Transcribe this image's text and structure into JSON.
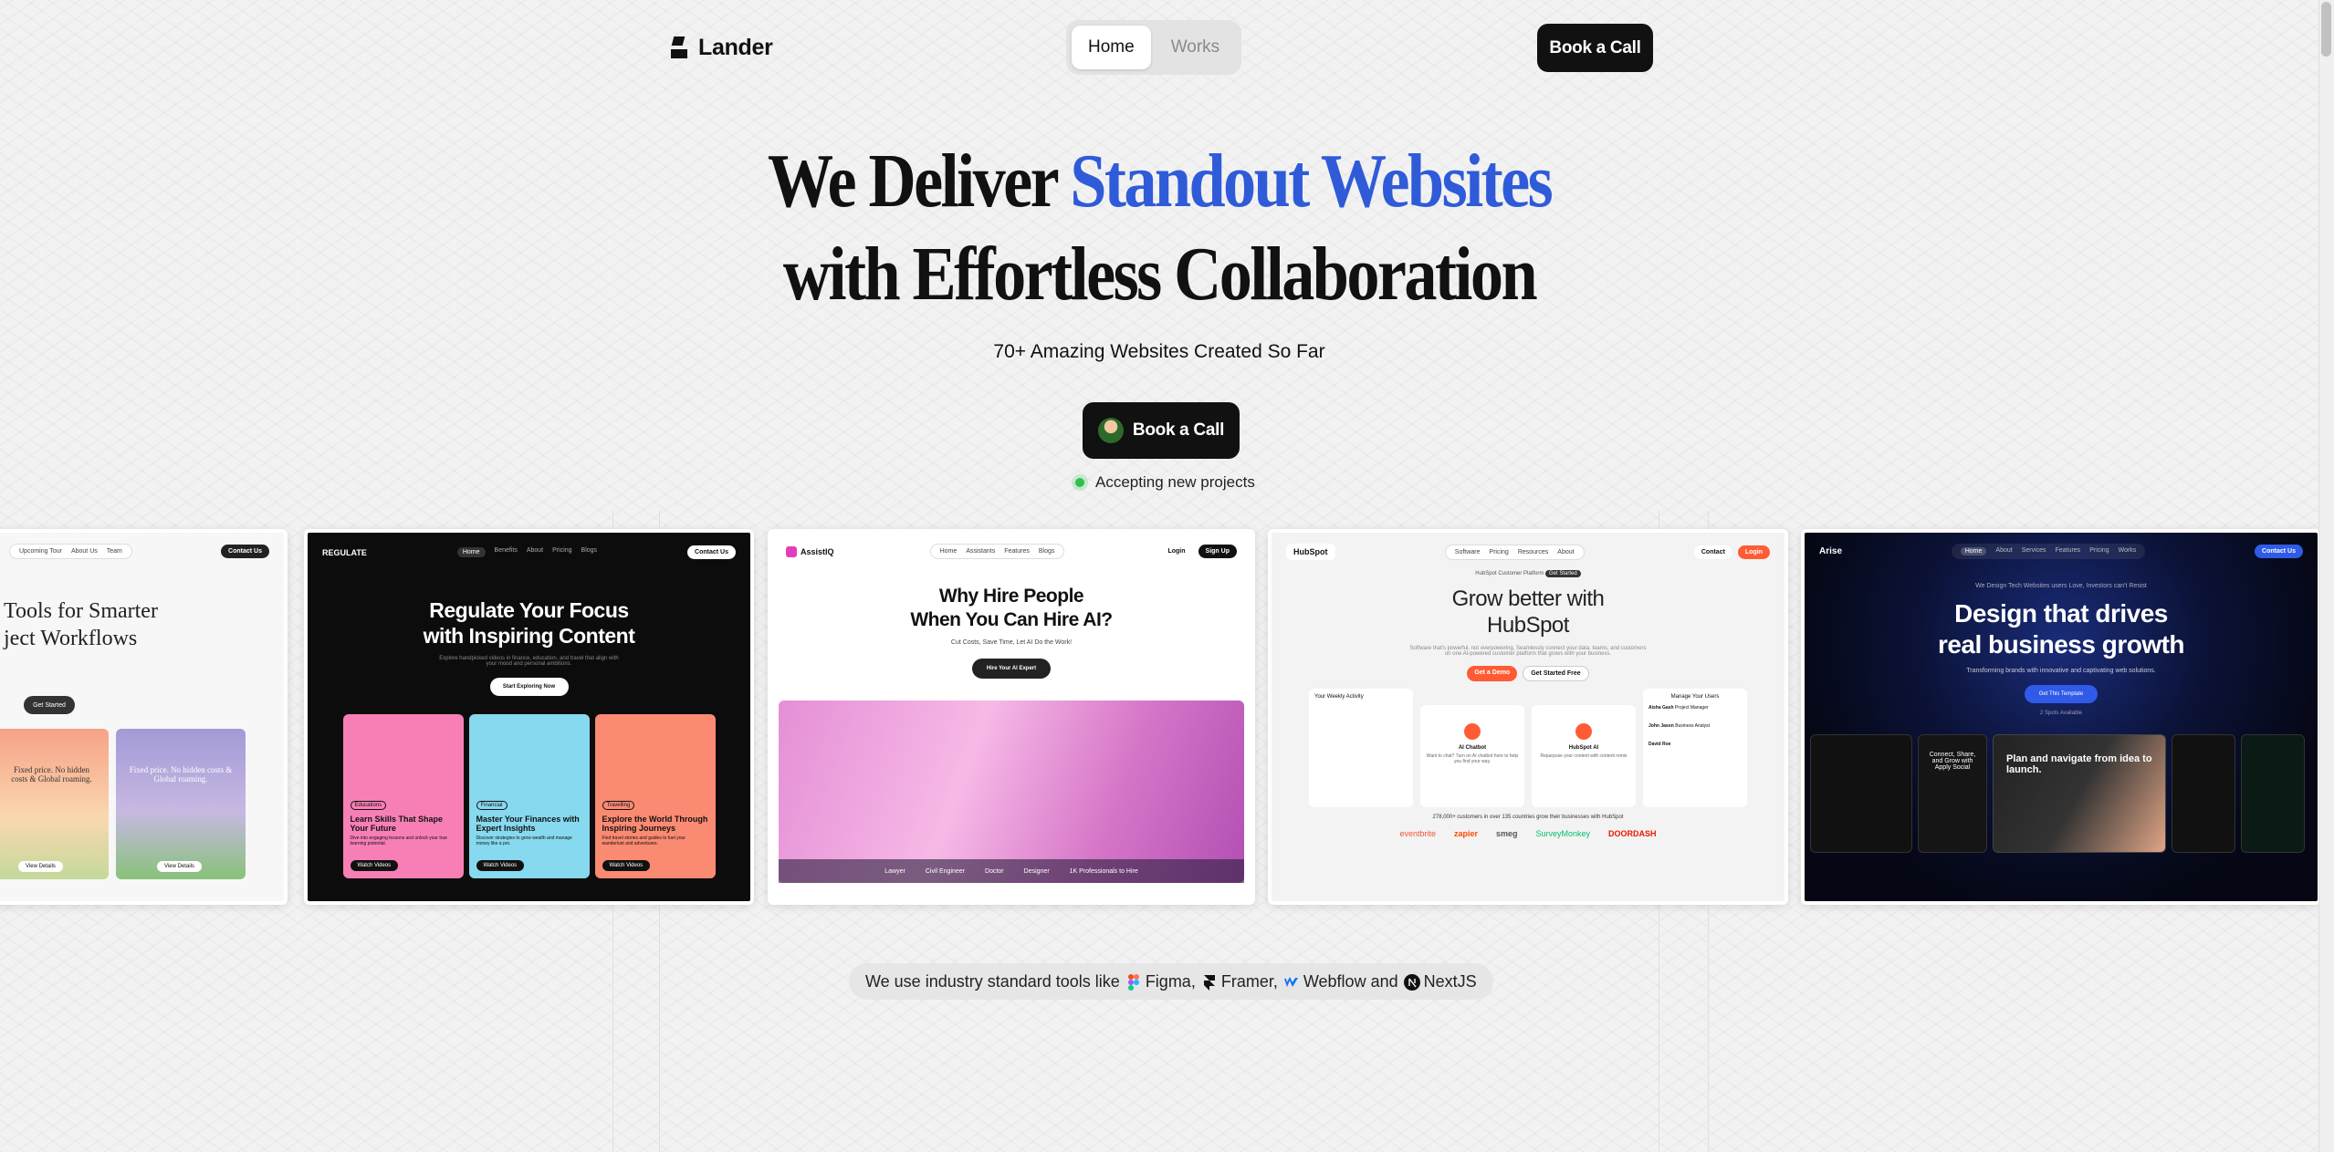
{
  "header": {
    "brand": "Lander",
    "tabs": [
      {
        "label": "Home",
        "active": true
      },
      {
        "label": "Works",
        "active": false
      }
    ],
    "cta_label": "Book a Call"
  },
  "hero": {
    "title_part1": "We Deliver ",
    "title_accent": "Standout Websites",
    "title_line2": "with Effortless Collaboration",
    "subtitle": "70+ Amazing Websites Created So Far",
    "cta_label": "Book a Call",
    "status": "Accepting new projects",
    "accent_color": "#2f5bd8"
  },
  "cards": {
    "card1": {
      "nav": [
        "Upcoming Tour",
        "About Us",
        "Team"
      ],
      "button": "Contact Us",
      "title_line1": "Tools for Smarter",
      "title_line2": "ject Workflows",
      "cta": "Get Started",
      "tile_text": "Fixed price. No hidden costs & Global roaming.",
      "tile_btn": "View Details"
    },
    "card2": {
      "brand": "REGULATE",
      "nav": [
        "Home",
        "Benefits",
        "About",
        "Pricing",
        "Blogs"
      ],
      "button": "Contact Us",
      "title_line1": "Regulate Your Focus",
      "title_line2": "with Inspiring Content",
      "subtitle": "Explore handpicked videos in finance, education, and travel that align with your mood and personal ambitions.",
      "cta": "Start Exploring Now",
      "tiles": [
        {
          "tag": "Educations",
          "title": "Learn Skills That Shape Your Future",
          "desc": "Dive into engaging lessons and unlock your true learning potential.",
          "btn": "Watch Videos",
          "color": "#f77fb6"
        },
        {
          "tag": "Financial",
          "title": "Master Your Finances with Expert Insights",
          "desc": "Discover strategies to grow wealth and manage money like a pro.",
          "btn": "Watch Videos",
          "color": "#86d9ee"
        },
        {
          "tag": "Travelling",
          "title": "Explore the World Through Inspiring Journeys",
          "desc": "Find travel stories and guides to fuel your wanderlust and adventures.",
          "btn": "Watch Videos",
          "color": "#fa8a72"
        }
      ]
    },
    "card3": {
      "brand": "AssistIQ",
      "nav": [
        "Home",
        "Assistants",
        "Features",
        "Blogs"
      ],
      "login": "Login",
      "signup": "Sign Up",
      "title_line1": "Why Hire People",
      "title_line2": "When You Can Hire AI?",
      "subtitle": "Cut Costs, Save Time, Let AI Do the Work!",
      "cta": "Hire Your AI Expert",
      "roles": [
        "Lawyer",
        "Civil Engineer",
        "Doctor",
        "Designer",
        "1K Professionals to Hire"
      ]
    },
    "card4": {
      "brand": "HubSpot",
      "nav": [
        "Software",
        "Pricing",
        "Resources",
        "About"
      ],
      "contact": "Contact",
      "login": "Login",
      "badge": "HubSpot Customer Platform",
      "badge_btn": "Get Started",
      "title_line1": "Grow better with",
      "title_line2": "HubSpot",
      "subtitle": "Software that's powerful, not overpowering. Seamlessly connect your data, teams, and customers on one AI-powered customer platform that grows with your business.",
      "demo_btn": "Get a Demo",
      "free_btn": "Get Started Free",
      "weekly": "Your Weekly Activity",
      "users": "Manage Your Users",
      "chatbot": "AI Chatbot",
      "chatbot_desc": "Want to chat? Turn on AI chatbot here to help you find your way.",
      "hubspot_ai": "HubSpot AI",
      "hubspot_ai_desc": "Repurpose your content with content remix",
      "customers": "278,000+ customers in over 135 countries grow their businesses with HubSpot",
      "logos": [
        "eventbrite",
        "zapier",
        "smeg",
        "SurveyMonkey",
        "DOORDASH"
      ],
      "user_list": [
        {
          "name": "Aisha Gash",
          "role": "Project Manager"
        },
        {
          "name": "John Jason",
          "role": "Business Analyst"
        },
        {
          "name": "David Roe",
          "role": ""
        }
      ]
    },
    "card5": {
      "brand": "Arise",
      "nav": [
        "Home",
        "About",
        "Services",
        "Features",
        "Pricing",
        "Works"
      ],
      "button": "Contact Us",
      "badge": "We Design Tech Websites users Love, Investors can't Resist",
      "title_line1": "Design that drives",
      "title_line2": "real business growth",
      "subtitle": "Transforming brands with innovative and captivating web solutions.",
      "cta": "Get This Template",
      "spots": "2 Spots Available",
      "screens": [
        "Plan and navigate from idea to launch.",
        "Connect, Share, and Grow with Apply Social"
      ]
    }
  },
  "tools": {
    "intro": "We use industry standard tools like",
    "items": [
      {
        "name": "Figma",
        "sep": ","
      },
      {
        "name": "Framer",
        "sep": ","
      },
      {
        "name": "Webflow",
        "sep": " and"
      },
      {
        "name": "NextJS",
        "sep": ""
      }
    ]
  }
}
